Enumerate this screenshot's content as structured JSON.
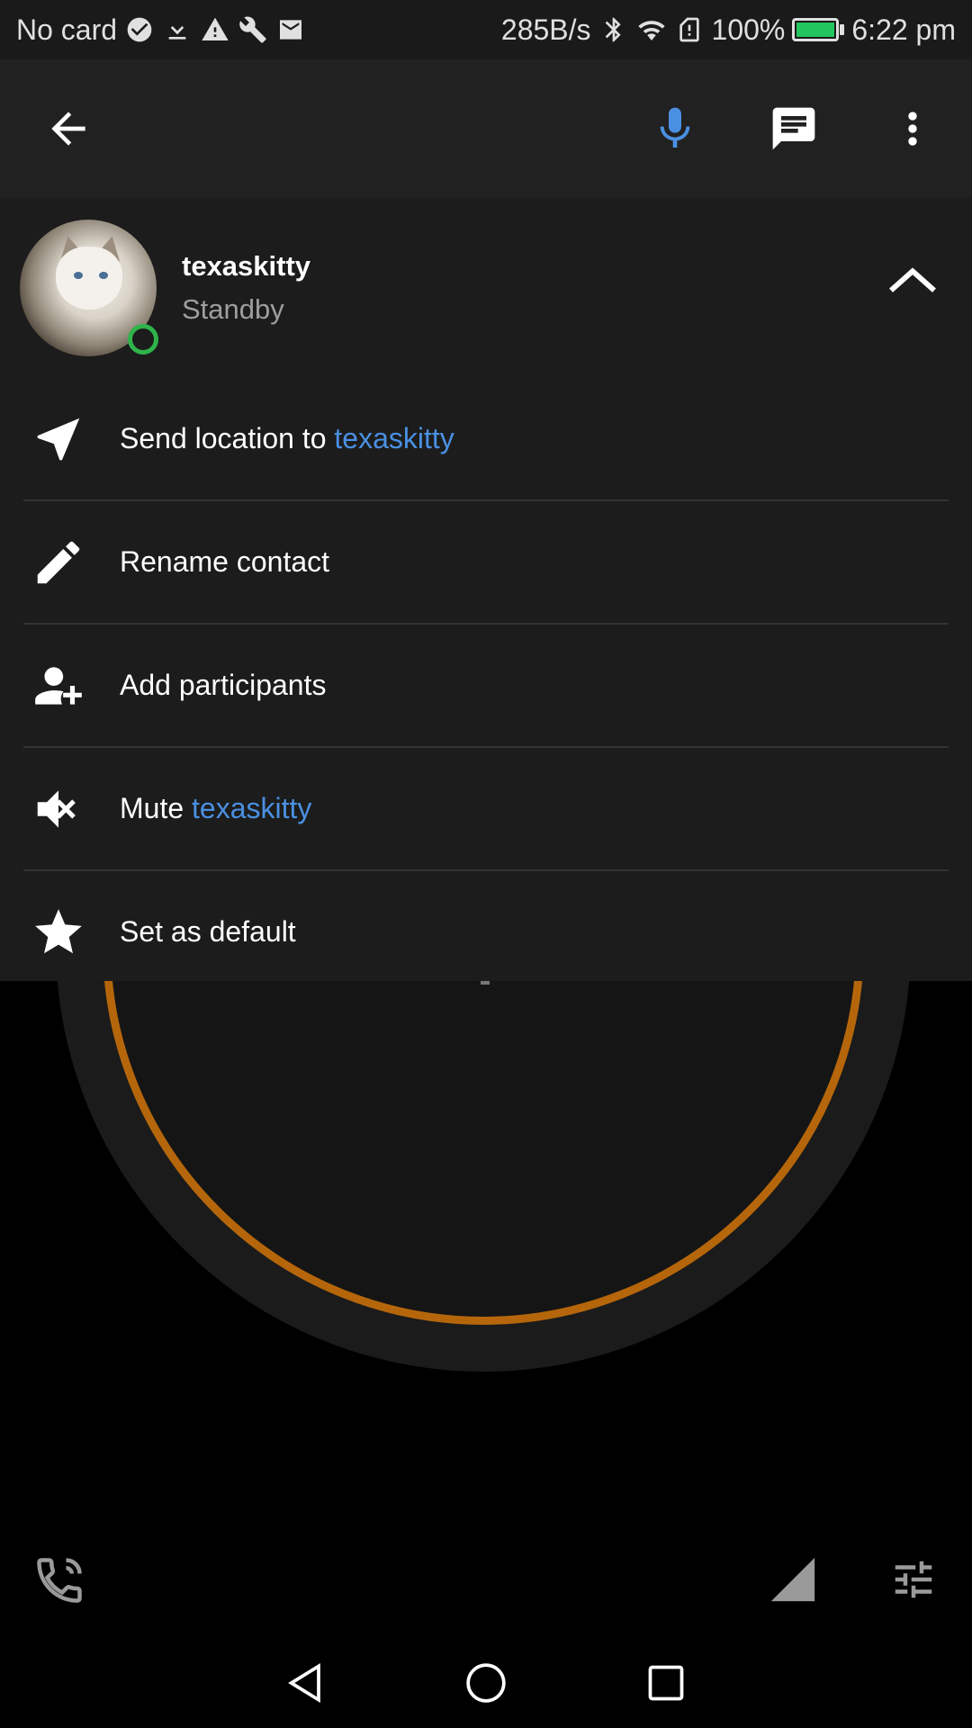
{
  "status_bar": {
    "carrier": "No card",
    "network_speed": "285B/s",
    "battery_percent": "100%",
    "battery_level": 1.0,
    "time": "6:22 pm",
    "icons": [
      "check-circle-icon",
      "download-icon",
      "warning-icon",
      "wrench-icon",
      "mail-icon",
      "bluetooth-icon",
      "wifi-icon",
      "sim-alert-icon",
      "battery-icon"
    ]
  },
  "toolbar": {
    "back_icon": "arrow-back-icon",
    "mic_icon": "microphone-icon",
    "message_icon": "message-icon",
    "more_icon": "more-vertical-icon"
  },
  "contact": {
    "name": "texaskitty",
    "status": "Standby",
    "presence_color": "#2fb34a"
  },
  "menu": {
    "send_location_prefix": "Send location to ",
    "send_location_target": "texaskitty",
    "rename_contact": "Rename contact",
    "add_participants": "Add participants",
    "mute_prefix": "Mute ",
    "mute_target": "texaskitty",
    "set_default": "Set as default"
  },
  "colors": {
    "accent": "#4a90e2",
    "dial_ring": "#b5660b",
    "panel_bg": "#1c1c1c",
    "toolbar_bg": "#212121"
  }
}
